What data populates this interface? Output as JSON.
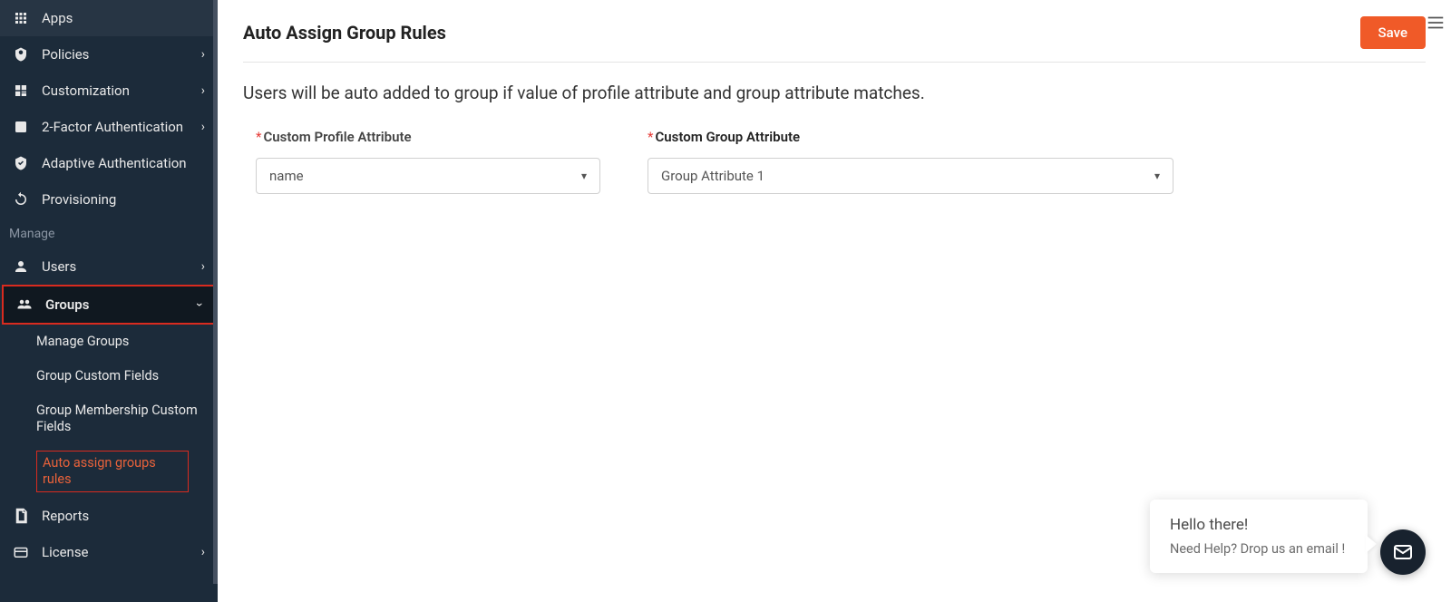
{
  "sidebar": {
    "items": [
      {
        "label": "Apps",
        "icon": "apps",
        "hasChev": false
      },
      {
        "label": "Policies",
        "icon": "policy",
        "hasChev": true
      },
      {
        "label": "Customization",
        "icon": "custom",
        "hasChev": true
      },
      {
        "label": "2-Factor Authentication",
        "icon": "2fa",
        "hasChev": true
      },
      {
        "label": "Adaptive Authentication",
        "icon": "adaptive",
        "hasChev": false
      },
      {
        "label": "Provisioning",
        "icon": "prov",
        "hasChev": false
      }
    ],
    "manage_label": "Manage",
    "manage_items": {
      "users": "Users",
      "groups": "Groups",
      "sub": [
        "Manage Groups",
        "Group Custom Fields",
        "Group Membership Custom Fields",
        "Auto assign groups rules"
      ],
      "reports": "Reports",
      "license": "License"
    }
  },
  "main": {
    "title": "Auto Assign Group Rules",
    "save": "Save",
    "description": "Users will be auto added to group if value of profile attribute and group attribute matches.",
    "profile_label": "Custom Profile Attribute",
    "group_label": "Custom Group Attribute",
    "profile_value": "name",
    "group_value": "Group Attribute 1"
  },
  "chat": {
    "greeting": "Hello there!",
    "helper": "Need Help? Drop us an email !"
  }
}
